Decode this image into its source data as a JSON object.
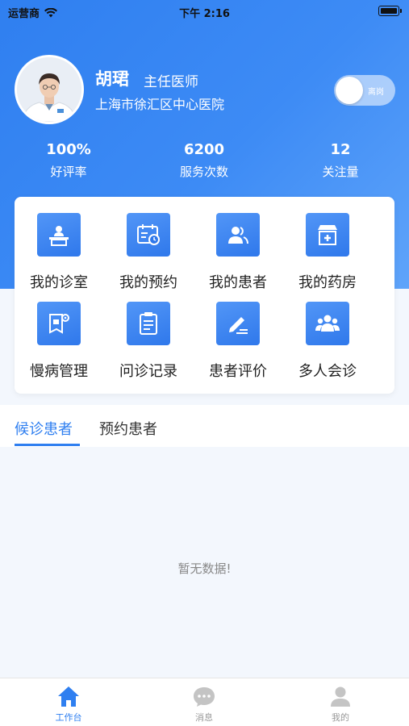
{
  "status_bar": {
    "carrier": "运营商",
    "time": "下午 2:16"
  },
  "profile": {
    "name": "胡珺",
    "title": "主任医师",
    "hospital": "上海市徐汇区中心医院",
    "toggle_text": "离岗"
  },
  "stats": [
    {
      "value": "100%",
      "label": "好评率"
    },
    {
      "value": "6200",
      "label": "服务次数"
    },
    {
      "value": "12",
      "label": "关注量"
    }
  ],
  "menu": [
    {
      "label": "我的诊室",
      "icon": "clinic-icon"
    },
    {
      "label": "我的预约",
      "icon": "appointment-icon"
    },
    {
      "label": "我的患者",
      "icon": "patients-icon"
    },
    {
      "label": "我的药房",
      "icon": "pharmacy-icon"
    },
    {
      "label": "慢病管理",
      "icon": "chronic-disease-icon"
    },
    {
      "label": "问诊记录",
      "icon": "clipboard-icon"
    },
    {
      "label": "患者评价",
      "icon": "edit-review-icon"
    },
    {
      "label": "多人会诊",
      "icon": "group-consult-icon"
    }
  ],
  "tabs": {
    "waiting": "候诊患者",
    "appointment": "预约患者"
  },
  "empty_text": "暂无数据!",
  "tabbar": {
    "workbench": "工作台",
    "messages": "消息",
    "mine": "我的"
  },
  "colors": {
    "primary": "#2f7ff0",
    "hero_end": "#5fa4fa"
  }
}
